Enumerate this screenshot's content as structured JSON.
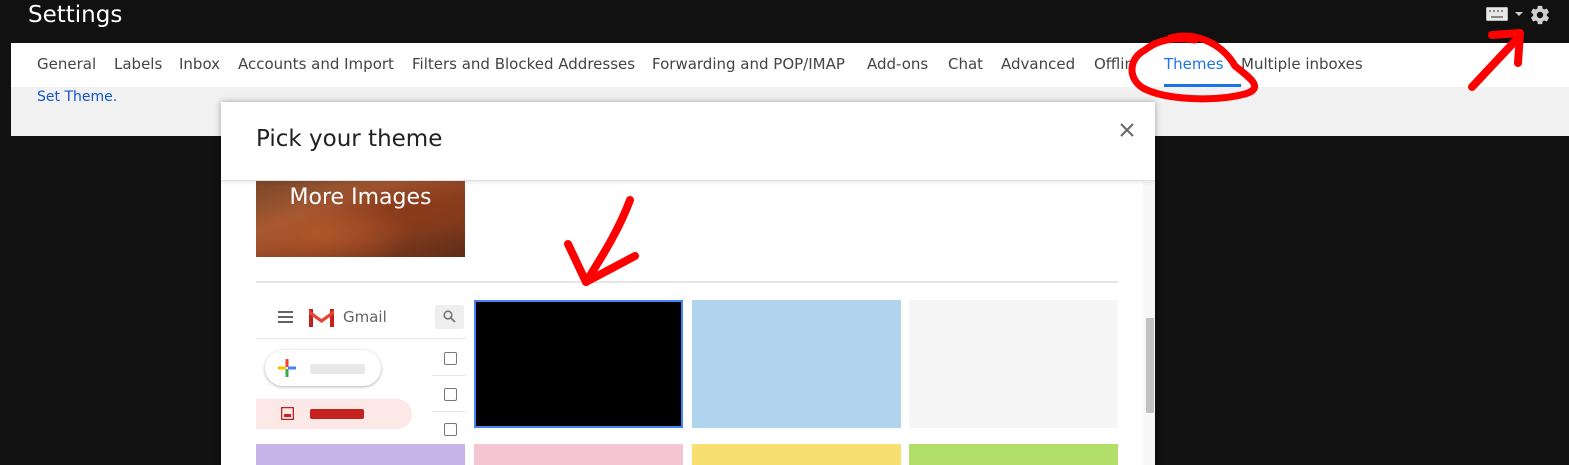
{
  "header": {
    "title": "Settings",
    "keyboard_icon": "keyboard-icon",
    "settings_icon": "gear-icon"
  },
  "tabs": [
    {
      "label": "General",
      "active": false
    },
    {
      "label": "Labels",
      "active": false
    },
    {
      "label": "Inbox",
      "active": false
    },
    {
      "label": "Accounts and Import",
      "active": false
    },
    {
      "label": "Filters and Blocked Addresses",
      "active": false
    },
    {
      "label": "Forwarding and POP/IMAP",
      "active": false
    },
    {
      "label": "Add-ons",
      "active": false
    },
    {
      "label": "Chat",
      "active": false
    },
    {
      "label": "Advanced",
      "active": false
    },
    {
      "label": "Offlin",
      "active": false
    },
    {
      "label": "Themes",
      "active": true
    },
    {
      "label": "Multiple inboxes",
      "active": false
    }
  ],
  "themes_page": {
    "set_theme_link": "Set Theme."
  },
  "dialog": {
    "title": "Pick your theme",
    "close_icon": "close-icon",
    "more_images_label": "More Images",
    "preview": {
      "app_name": "Gmail",
      "menu_icon": "menu-icon",
      "logo_icon": "gmail-m-icon",
      "search_icon": "search-icon",
      "compose_icon": "compose-plus-icon",
      "inbox_icon": "inbox-icon"
    },
    "swatches_row1": [
      {
        "color": "#000000",
        "selected": true
      },
      {
        "color": "#b1d4ee",
        "selected": false
      },
      {
        "color": "#f5f5f5",
        "selected": false
      }
    ],
    "swatches_row2": [
      {
        "color": "#c9b4ea",
        "selected": false
      },
      {
        "color": "#f5c4d3",
        "selected": false
      },
      {
        "color": "#f8df72",
        "selected": false
      },
      {
        "color": "#b2de6a",
        "selected": false
      }
    ]
  },
  "colors": {
    "accent": "#1a73e8",
    "link": "#1155cc",
    "annotation_red": "#ff0000",
    "dark_background": "#111111"
  }
}
